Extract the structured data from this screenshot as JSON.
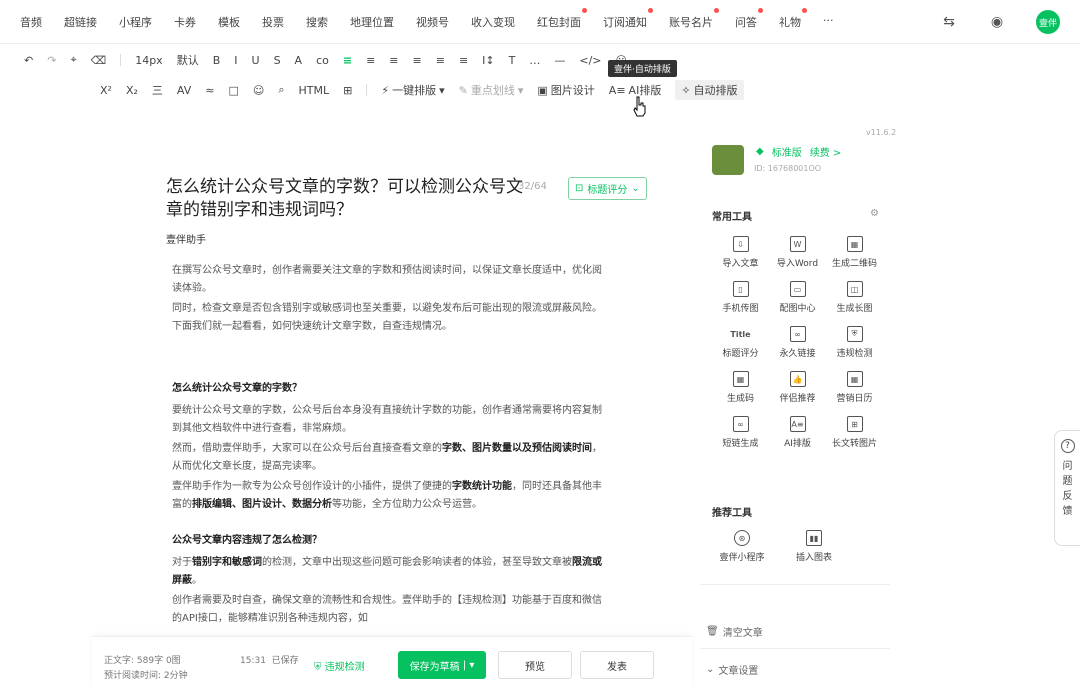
{
  "topnav": [
    "音频",
    "超链接",
    "小程序",
    "卡券",
    "模板",
    "投票",
    "搜索",
    "地理位置",
    "视频号",
    "收入变现",
    "红包封面",
    "订阅通知",
    "账号名片",
    "问答",
    "礼物"
  ],
  "topnav_dots": [
    false,
    false,
    false,
    false,
    false,
    false,
    false,
    false,
    false,
    false,
    true,
    true,
    true,
    true,
    true
  ],
  "top_avatar": "壹伴",
  "toolbar1": [
    "14px",
    "默认",
    "B",
    "I",
    "U",
    "S",
    "A",
    "co",
    "≡",
    "≡",
    "≡",
    "≡",
    "≡",
    "≡",
    "I↕",
    "T"
  ],
  "toolbar2": [
    "X²",
    "X₂",
    "三",
    "AV",
    "≈",
    "□",
    "☺",
    "⌕",
    "HTML",
    "⊞"
  ],
  "tool_oneclick": "一键排版",
  "tool_focus": "重点划线",
  "tool_imgdesign": "图片设计",
  "tool_ai": "AI排版",
  "tool_auto": "自动排版",
  "tooltip": "壹伴·自动排版",
  "doc": {
    "title": "怎么统计公众号文章的字数？可以检测公众号文章的错别字和违规词吗？",
    "count": "32/64",
    "score_btn": "标题评分",
    "author": "壹伴助手",
    "p1": "在撰写公众号文章时，创作者需要关注文章的字数和预估阅读时间，以保证文章长度适中，优化阅读体验。",
    "p2": "同时，检查文章是否包含错别字或敏感词也至关重要，以避免发布后可能出现的限流或屏蔽风险。下面我们就一起看看，如何快速统计文章字数，自查违规情况。",
    "h1": "怎么统计公众号文章的字数？",
    "p3": "要统计公众号文章的字数，公众号后台本身没有直接统计字数的功能，创作者通常需要将内容复制到其他文档软件中进行查看，非常麻烦。",
    "p4a": "然而，借助壹伴助手，大家可以在公众号后台直接查看文章的",
    "p4b": "字数、图片数量以及预估阅读时间",
    "p4c": "，从而优化文章长度，提高完读率。",
    "p5a": "壹伴助手作为一款专为公众号创作设计的小插件，提供了便捷的",
    "p5b": "字数统计功能",
    "p5c": "，同时还具备其他丰富的",
    "p5d": "排版编辑、图片设计、数据分析",
    "p5e": "等功能，全方位助力公众号运营。",
    "h2": "公众号文章内容违规了怎么检测？",
    "p6a": "对于",
    "p6b": "错别字和敏感词",
    "p6c": "的检测，文章中出现这些问题可能会影响读者的体验，甚至导致文章被",
    "p6d": "限流或屏蔽",
    "p6e": "。",
    "p7": "创作者需要及时自查，确保文章的流畅性和合规性。壹伴助手的【违规检测】功能基于百度和微信的API接口，能够精准识别各种违规内容，如"
  },
  "sidebar": {
    "version": "v11.6.2",
    "plan": "标准版",
    "upgrade": "续费 >",
    "user_id": "ID: 16768001OO",
    "common_tools": "常用工具",
    "tools": [
      "导入文章",
      "导入Word",
      "生成二维码",
      "手机传图",
      "配图中心",
      "生成长图",
      "标题评分",
      "永久链接",
      "违规检测",
      "生成码",
      "伴侣推荐",
      "营销日历",
      "短链生成",
      "AI排版",
      "长文转图片"
    ],
    "tool_icons": [
      "⇩",
      "W",
      "▦",
      "▯",
      "▭",
      "◫",
      "Title",
      "∞",
      "⛨",
      "▦",
      "👍",
      "▦",
      "∞",
      "A≡",
      "⊞"
    ],
    "rec_tools": "推荐工具",
    "rec": [
      "壹伴小程序",
      "插入图表"
    ],
    "rec_icons": [
      "⊛",
      "▮▮"
    ],
    "clear": "清空文章",
    "settings": "文章设置"
  },
  "feedback": [
    "问",
    "题",
    "反",
    "馈"
  ],
  "bottom": {
    "word_label": "正文字",
    "word_value": "589字 0图",
    "read_label": "预计阅读时间",
    "read_value": "2分钟",
    "time": "15:31",
    "saved": "已保存",
    "check": "违规检测",
    "save": "保存为草稿",
    "preview": "预览",
    "publish": "发表"
  }
}
